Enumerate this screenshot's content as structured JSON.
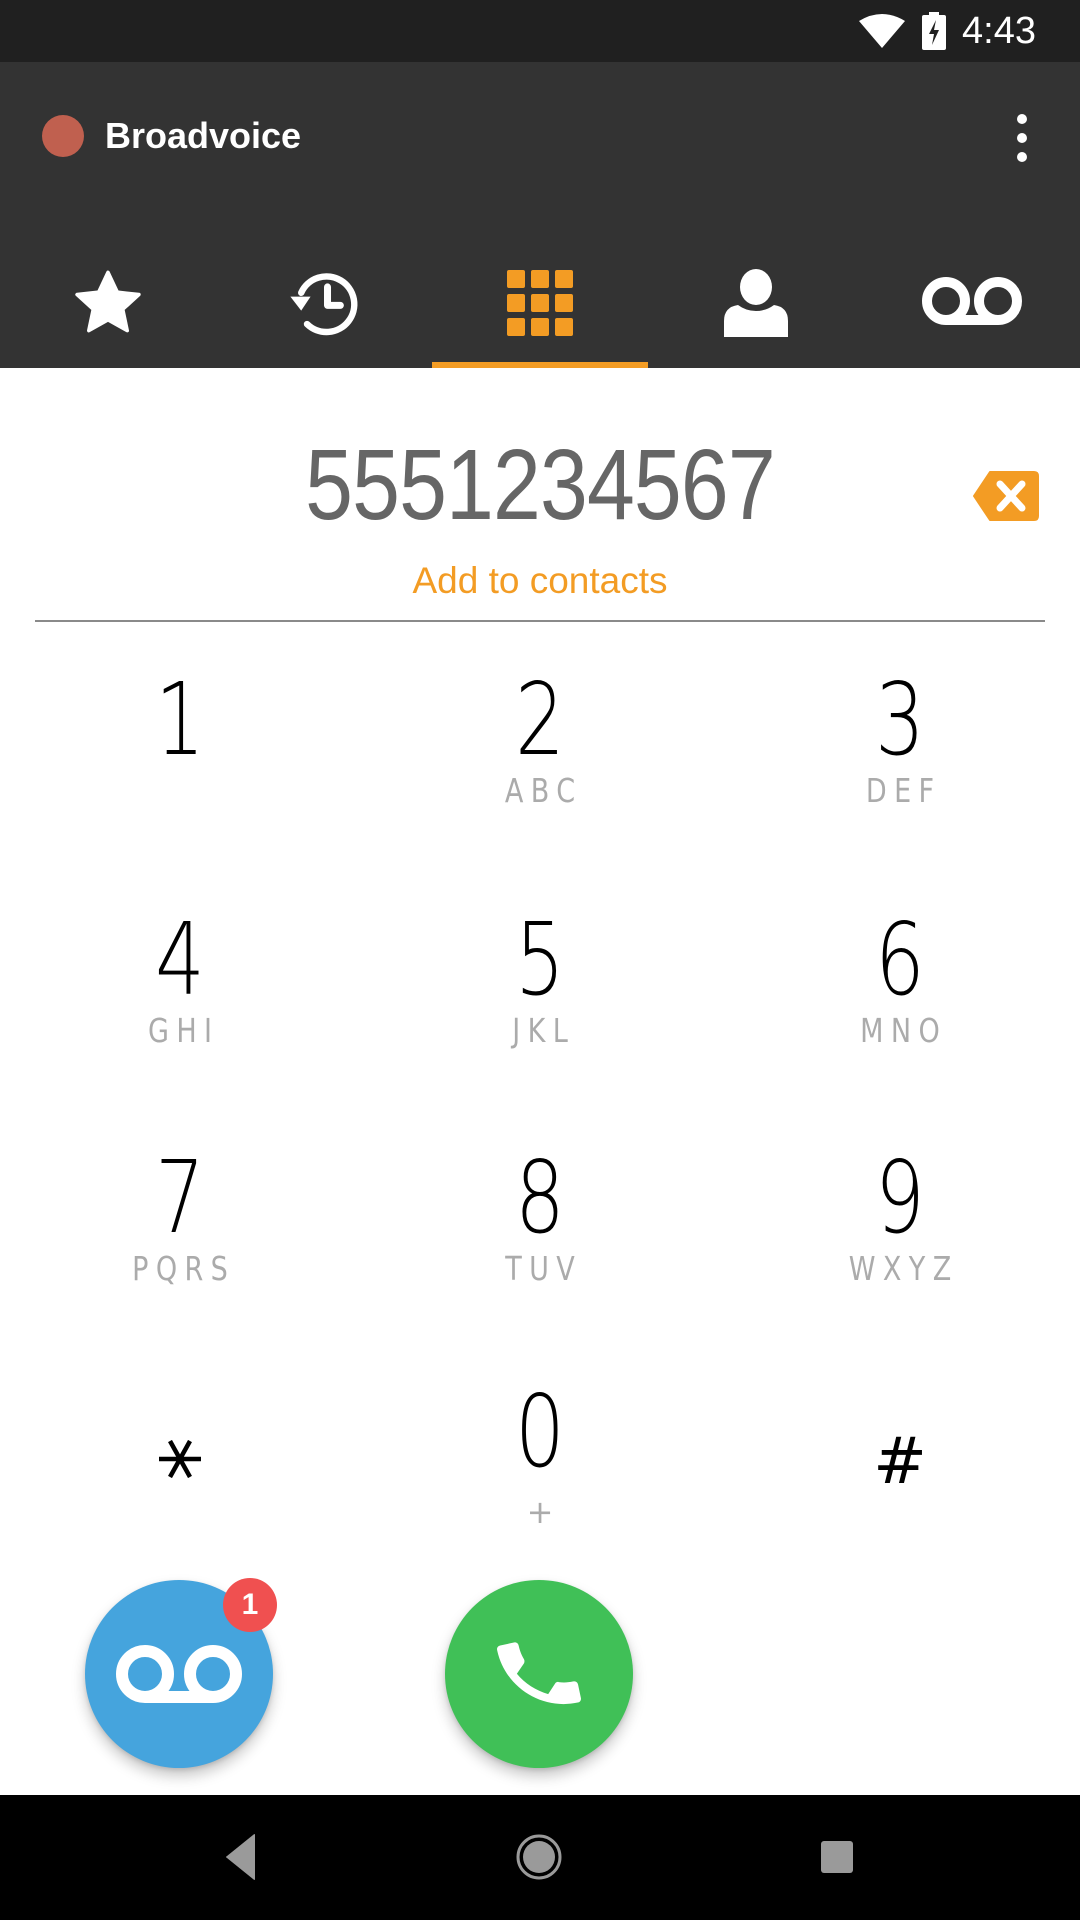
{
  "status_bar": {
    "time": "4:43",
    "icons": [
      "wifi-icon",
      "battery-charging-icon"
    ]
  },
  "app_bar": {
    "title": "Broadvoice",
    "presence_status_color": "#C0604F",
    "overflow_icon": "more-vert-icon"
  },
  "tabs": [
    {
      "name": "favorites",
      "icon": "star-icon",
      "selected": false
    },
    {
      "name": "recents",
      "icon": "history-icon",
      "selected": false
    },
    {
      "name": "dialpad",
      "icon": "dialpad-icon",
      "selected": true
    },
    {
      "name": "contacts",
      "icon": "person-icon",
      "selected": false
    },
    {
      "name": "voicemail",
      "icon": "voicemail-icon",
      "selected": false
    }
  ],
  "dialer": {
    "number": "5551234567",
    "add_to_contacts": "Add to contacts",
    "backspace_icon": "backspace-icon"
  },
  "keypad": {
    "keys": [
      {
        "digit": "1",
        "letters": ""
      },
      {
        "digit": "2",
        "letters": "ABC"
      },
      {
        "digit": "3",
        "letters": "DEF"
      },
      {
        "digit": "4",
        "letters": "GHI"
      },
      {
        "digit": "5",
        "letters": "JKL"
      },
      {
        "digit": "6",
        "letters": "MNO"
      },
      {
        "digit": "7",
        "letters": "PQRS"
      },
      {
        "digit": "8",
        "letters": "TUV"
      },
      {
        "digit": "9",
        "letters": "WXYZ"
      },
      {
        "digit": "*",
        "letters": ""
      },
      {
        "digit": "0",
        "letters": "+"
      },
      {
        "digit": "#",
        "letters": ""
      }
    ]
  },
  "actions": {
    "voicemail_badge_count": "1",
    "voicemail_icon": "voicemail-icon",
    "call_icon": "phone-icon"
  },
  "colors": {
    "accent": "#F39C24",
    "app_bar": "#333333",
    "status_bar": "#202020",
    "voicemail_fab": "#45A4DD",
    "call_fab": "#40C057",
    "badge": "#F05050"
  },
  "nav_bar": {
    "buttons": [
      "back",
      "home",
      "recents"
    ]
  }
}
